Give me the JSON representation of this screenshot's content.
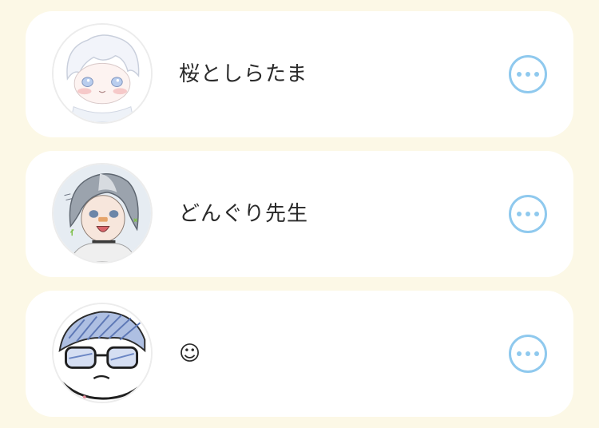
{
  "colors": {
    "page_background": "#fcf8e6",
    "card_background": "#ffffff",
    "more_button_accent": "#8fc9ee",
    "name_text": "#2a2a2a"
  },
  "users": [
    {
      "name": "桜としらたま",
      "avatar_icon": "user-avatar-icon",
      "more_icon": "more-options-icon"
    },
    {
      "name": "どんぐり先生",
      "avatar_icon": "user-avatar-icon",
      "more_icon": "more-options-icon"
    },
    {
      "name": "☺",
      "avatar_icon": "user-avatar-icon",
      "more_icon": "more-options-icon"
    }
  ]
}
